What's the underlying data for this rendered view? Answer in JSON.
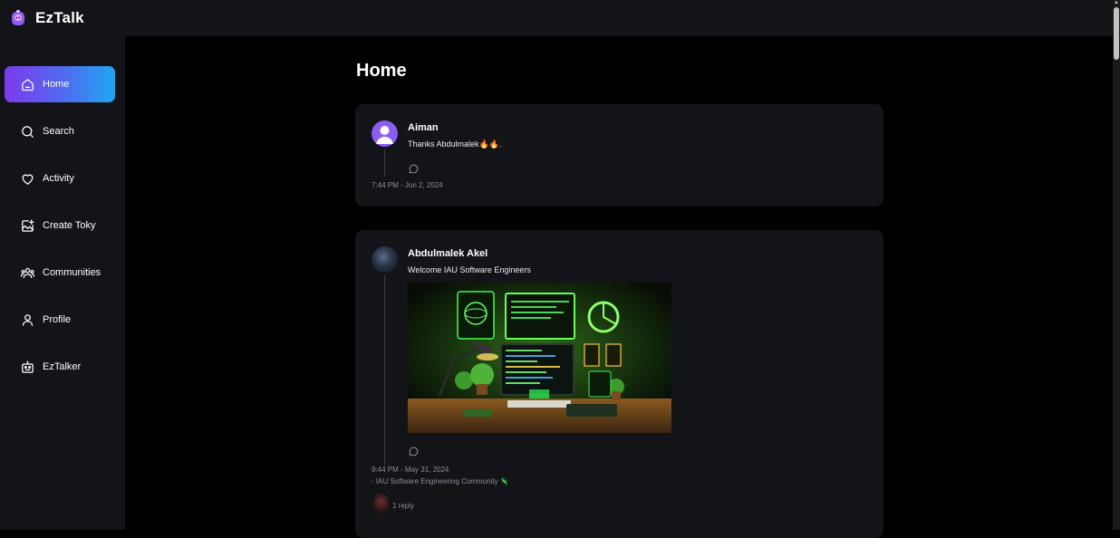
{
  "app": {
    "name": "EzTalk"
  },
  "sidebar": {
    "items": [
      {
        "label": "Home",
        "icon": "home-icon",
        "active": true
      },
      {
        "label": "Search",
        "icon": "search-icon",
        "active": false
      },
      {
        "label": "Activity",
        "icon": "heart-icon",
        "active": false
      },
      {
        "label": "Create Toky",
        "icon": "create-post-icon",
        "active": false
      },
      {
        "label": "Communities",
        "icon": "communities-icon",
        "active": false
      },
      {
        "label": "Profile",
        "icon": "user-icon",
        "active": false
      },
      {
        "label": "EzTalker",
        "icon": "robot-icon",
        "active": false
      }
    ]
  },
  "main": {
    "title": "Home",
    "posts": [
      {
        "author": "Aiman",
        "text": "Thanks Abdulmalek🔥🔥.",
        "timestamp": "7:44 PM - Jun 2, 2024"
      },
      {
        "author": "Abdulmalek Akel",
        "text": "Welcome IAU Software Engineers",
        "timestamp": "9:44 PM - May 31, 2024",
        "community": "- IAU Software Engineering Community",
        "community_emoji": "🦎",
        "replies": "1 reply",
        "image_alt": "neon-coding-desk-illustration"
      }
    ]
  },
  "colors": {
    "accent_start": "#7c3aed",
    "accent_end": "#1ea7f2",
    "card_bg": "#121417",
    "muted_text": "#8a8f99"
  }
}
